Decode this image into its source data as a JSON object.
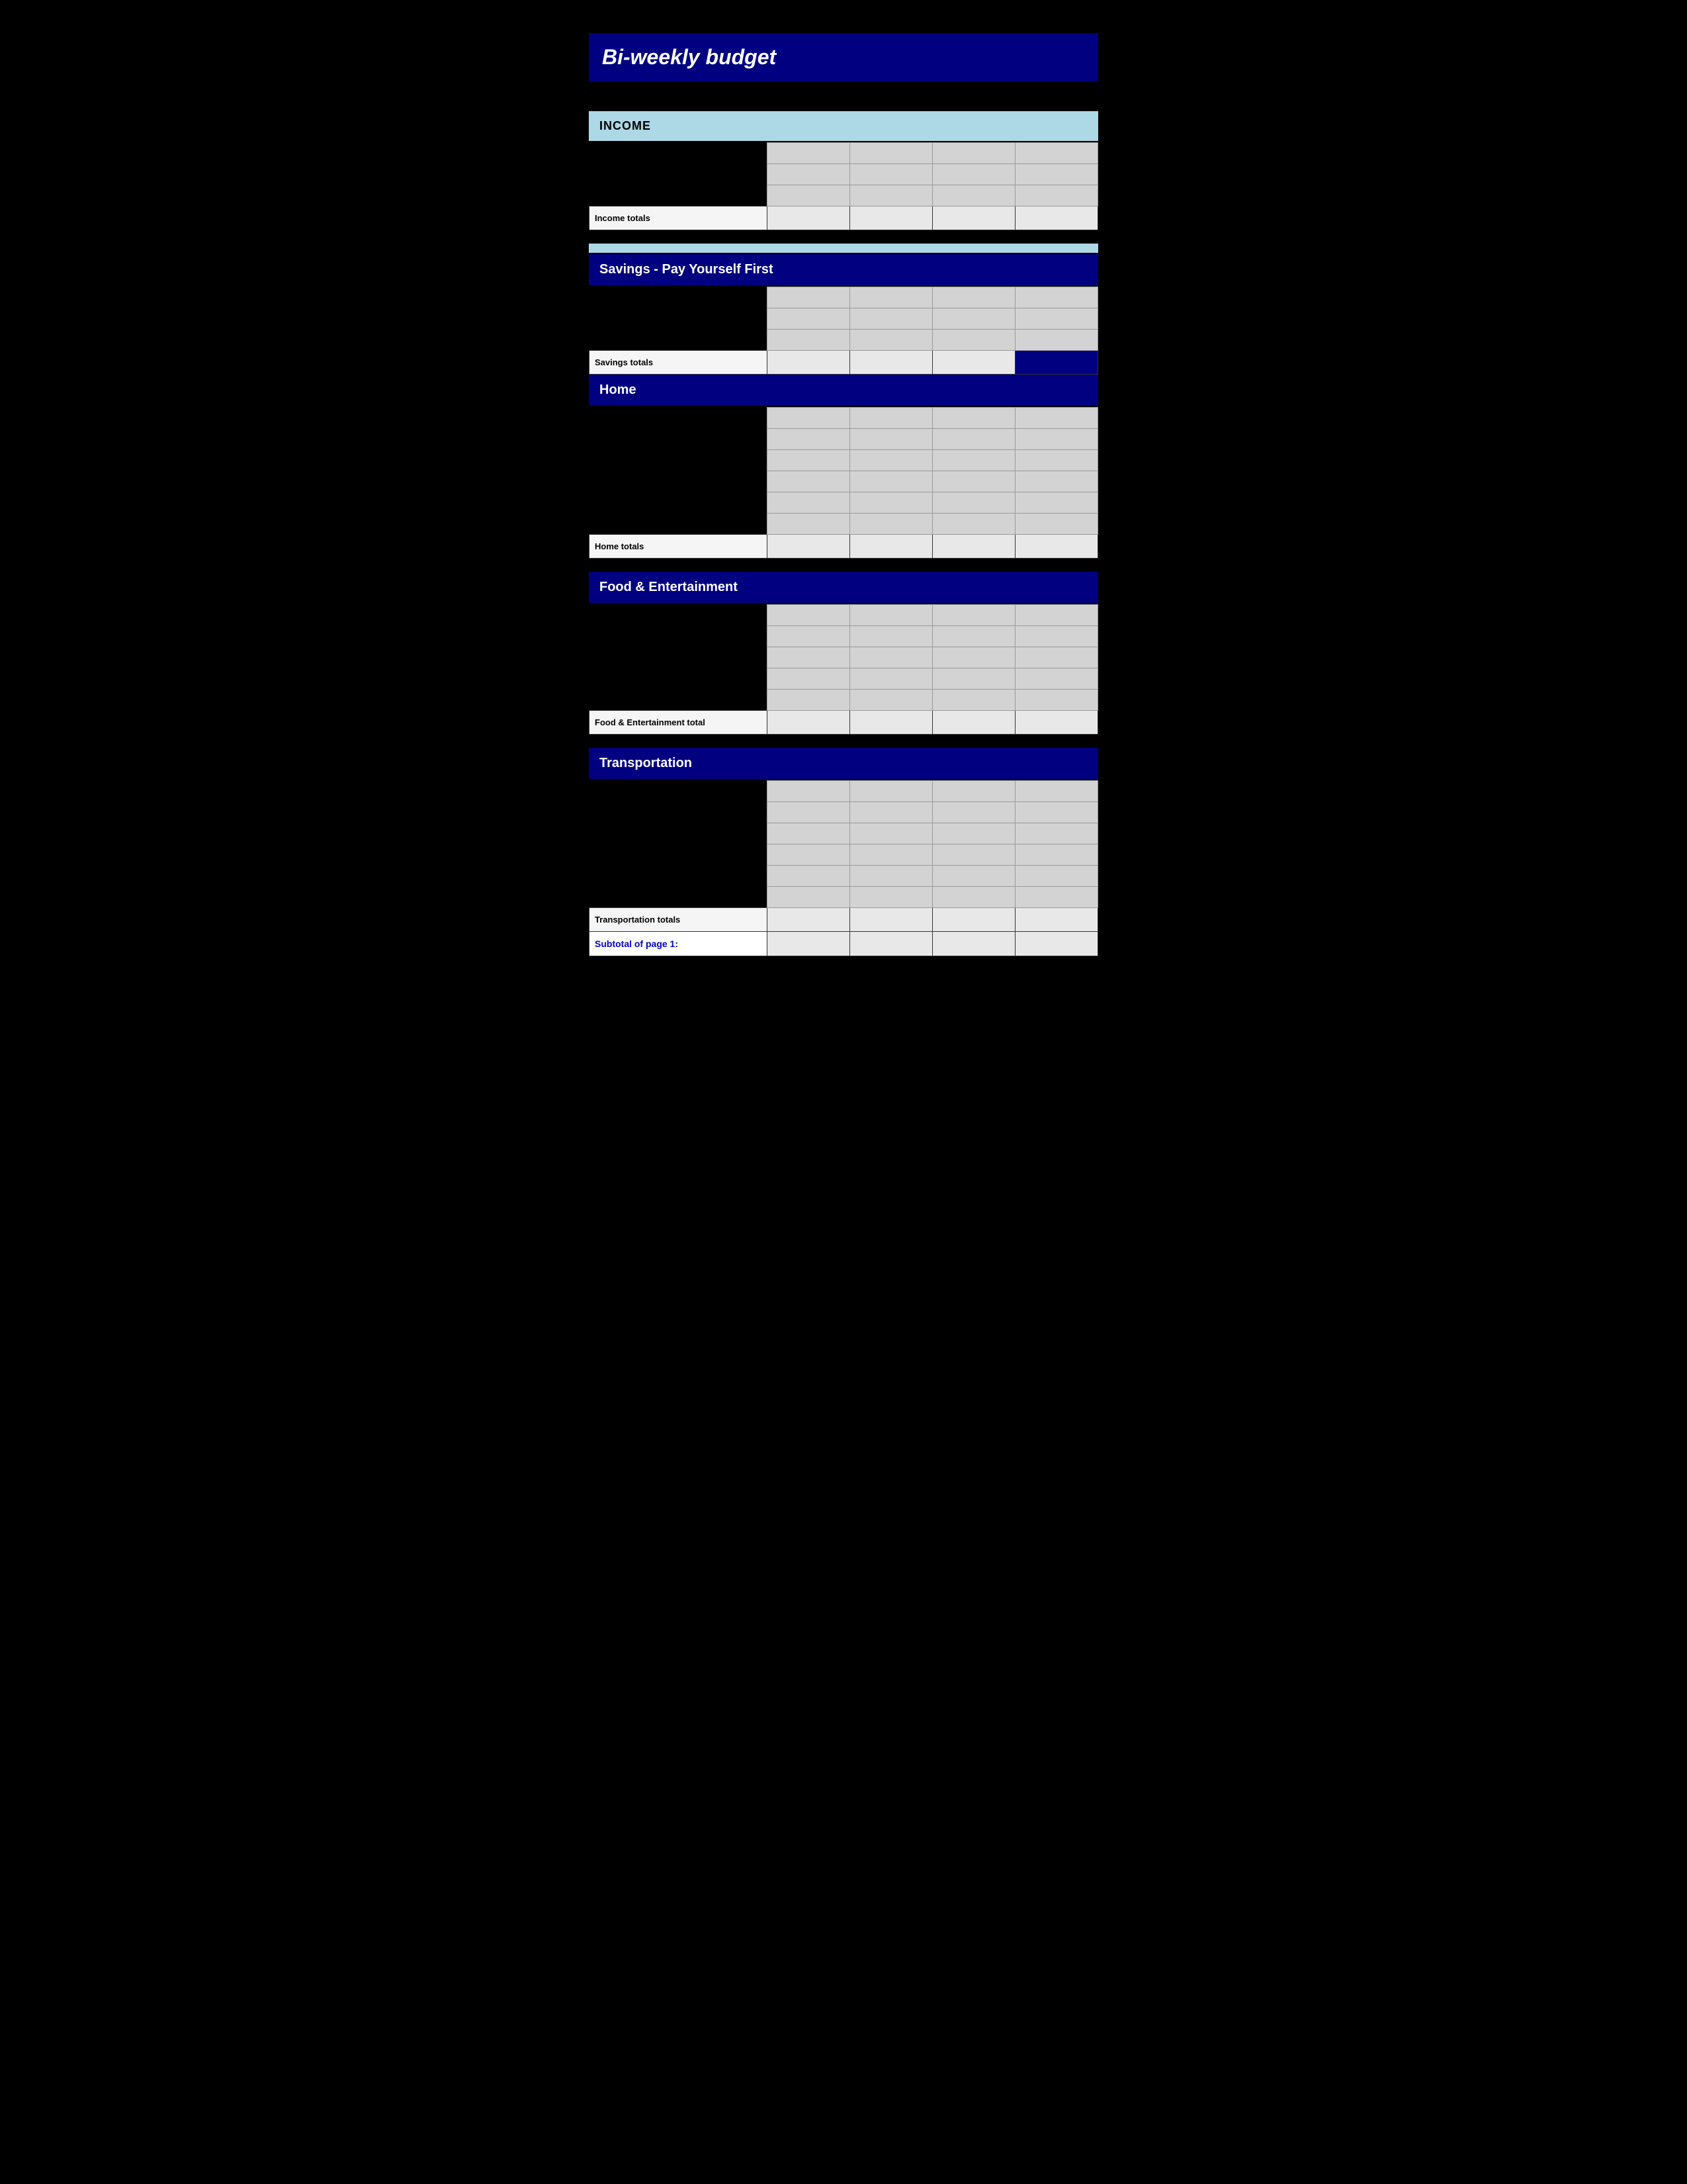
{
  "title": "Bi-weekly  budget",
  "sections": {
    "income": {
      "header": "Income",
      "totals_label": "Income totals"
    },
    "savings": {
      "header": "Savings - Pay Yourself First",
      "totals_label": "Savings totals"
    },
    "home": {
      "header": "Home",
      "totals_label": "Home totals"
    },
    "food": {
      "header": "Food & Entertainment",
      "totals_label": "Food & Entertainment total"
    },
    "transportation": {
      "header": "Transportation",
      "totals_label": "Transportation totals"
    },
    "subtotal": {
      "label": "Subtotal of page 1:"
    }
  }
}
